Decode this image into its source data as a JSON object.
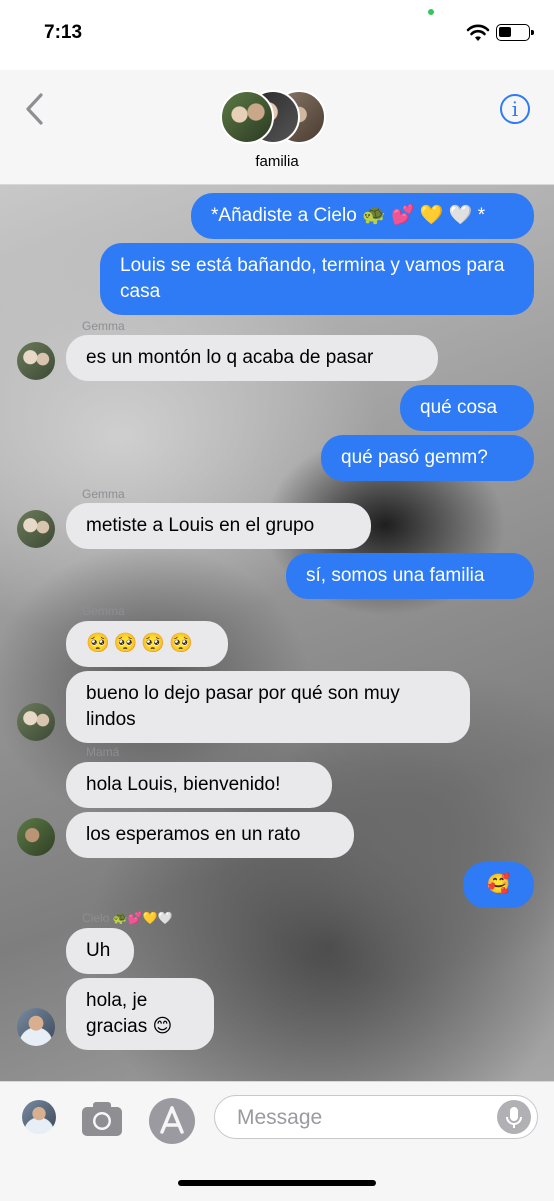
{
  "status": {
    "time": "7:13"
  },
  "header": {
    "group_name": "familia",
    "back_icon": "chevron-left-icon",
    "info_icon": "info-icon"
  },
  "messages": [
    {
      "type": "sent",
      "text": "*Añadiste a Cielo 🐢 💕 💛 🤍 *"
    },
    {
      "type": "sent",
      "text": "Louis se está bañando, termina y vamos para casa"
    },
    {
      "type": "received",
      "sender": "Gemma",
      "text": "es un montón lo q acaba de pasar"
    },
    {
      "type": "sent",
      "text": "qué cosa"
    },
    {
      "type": "sent",
      "text": "qué pasó gemm?"
    },
    {
      "type": "received",
      "sender": "Gemma",
      "text": "metiste a Louis en el grupo"
    },
    {
      "type": "sent",
      "text": "sí, somos una familia"
    },
    {
      "type": "received",
      "sender": "Gemma",
      "text": "🥺🥺🥺🥺"
    },
    {
      "type": "received",
      "text": "bueno lo dejo pasar por qué son muy lindos"
    },
    {
      "type": "received",
      "sender": "Mamá",
      "text": "hola Louis, bienvenido!"
    },
    {
      "type": "received",
      "text": "los esperamos en un rato"
    },
    {
      "type": "sent",
      "text": "🥰"
    },
    {
      "type": "received",
      "sender": "Cielo 🐢💕💛🤍",
      "text": "Uh"
    },
    {
      "type": "received",
      "text": "hola, je gracias 😊"
    }
  ],
  "input": {
    "placeholder": "Message",
    "camera_icon": "camera-icon",
    "apps_icon": "app-store-icon",
    "mic_icon": "microphone-icon"
  },
  "colors": {
    "sent_bubble": "#2f7bf5",
    "received_bubble": "#e9e9eb",
    "accent": "#2f7bf5"
  }
}
